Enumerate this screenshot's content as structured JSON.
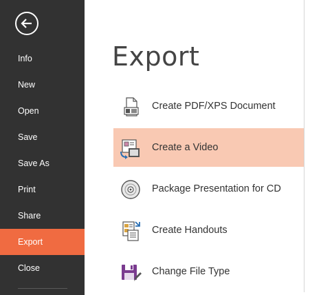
{
  "sidebar": {
    "items": [
      {
        "label": "Info"
      },
      {
        "label": "New"
      },
      {
        "label": "Open"
      },
      {
        "label": "Save"
      },
      {
        "label": "Save As"
      },
      {
        "label": "Print"
      },
      {
        "label": "Share"
      },
      {
        "label": "Export"
      },
      {
        "label": "Close"
      }
    ],
    "active": "Export",
    "back_icon": "back-arrow-icon"
  },
  "main": {
    "title": "Export",
    "options": [
      {
        "label": "Create PDF/XPS Document",
        "icon": "pdf-document-icon"
      },
      {
        "label": "Create a Video",
        "icon": "video-icon",
        "selected": true
      },
      {
        "label": "Package Presentation for CD",
        "icon": "cd-icon"
      },
      {
        "label": "Create Handouts",
        "icon": "handouts-icon"
      },
      {
        "label": "Change File Type",
        "icon": "save-as-icon"
      }
    ]
  },
  "colors": {
    "sidebar_bg": "#323232",
    "active_bg": "#f06b41",
    "selected_bg": "#f9c9b3"
  }
}
